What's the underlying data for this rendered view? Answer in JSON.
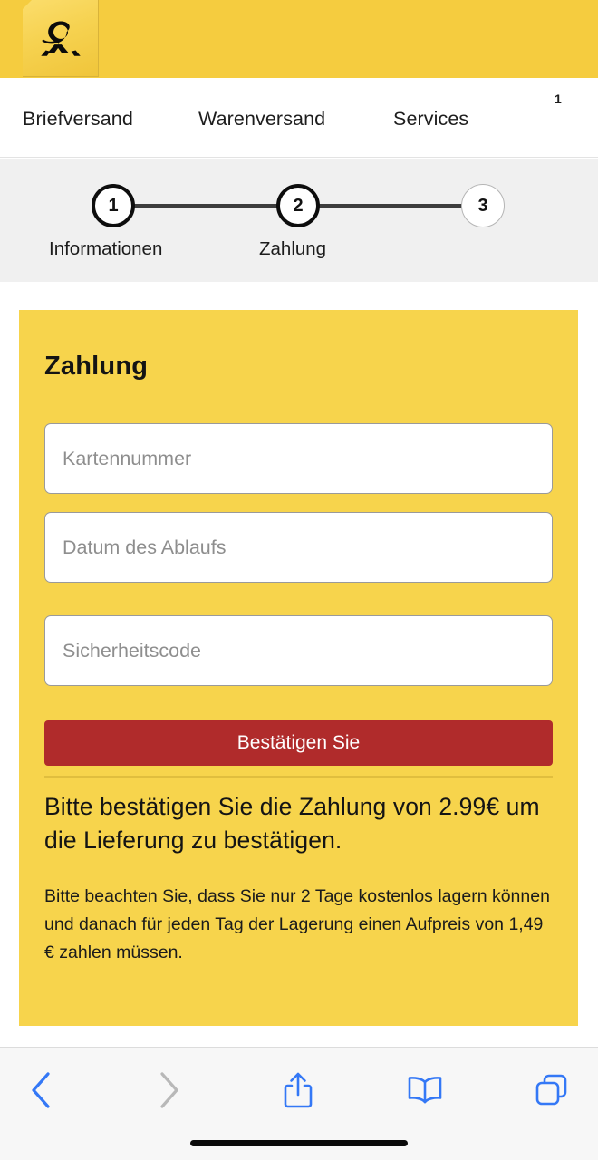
{
  "header": {
    "logo_name": "deutsche-post-horn-logo",
    "background_color": "#f5cc3f",
    "logo_tile_color": "#f6d250"
  },
  "nav": {
    "items": [
      {
        "label": "Briefversand"
      },
      {
        "label": "Warenversand"
      },
      {
        "label": "Services"
      }
    ],
    "badge": "1"
  },
  "stepper": {
    "background_color": "#f0f0f0",
    "steps": [
      {
        "number": "1",
        "label": "Informationen",
        "state": "active"
      },
      {
        "number": "2",
        "label": "Zahlung",
        "state": "active"
      },
      {
        "number": "3",
        "label": "",
        "state": "inactive"
      }
    ]
  },
  "payment_card": {
    "background_color": "#f7d44c",
    "title": "Zahlung",
    "fields": [
      {
        "placeholder": "Kartennummer",
        "value": ""
      },
      {
        "placeholder": "Datum des Ablaufs",
        "value": ""
      },
      {
        "placeholder": "Sicherheitscode",
        "value": ""
      }
    ],
    "submit_label": "Bestätigen Sie",
    "submit_color": "#b02b2b",
    "headline": "Bitte bestätigen Sie die Zahlung von 2.99€ um die Lieferung zu bestätigen.",
    "note": "Bitte beachten Sie, dass Sie nur 2 Tage kostenlos lagern können und danach für jeden Tag der Lagerung einen Aufpreis von 1,49 € zahlen müssen.",
    "amount": "2.99€",
    "storage_free_days": "2",
    "storage_surcharge": "1,49 €"
  },
  "toolbar": {
    "buttons": [
      {
        "icon": "back-chevron-icon",
        "state": "enabled",
        "color": "#3478f6"
      },
      {
        "icon": "forward-chevron-icon",
        "state": "disabled",
        "color": "#b8b8b8"
      },
      {
        "icon": "share-icon",
        "state": "enabled",
        "color": "#3478f6"
      },
      {
        "icon": "bookmarks-book-icon",
        "state": "enabled",
        "color": "#3478f6"
      },
      {
        "icon": "tabs-icon",
        "state": "enabled",
        "color": "#3478f6"
      }
    ]
  }
}
